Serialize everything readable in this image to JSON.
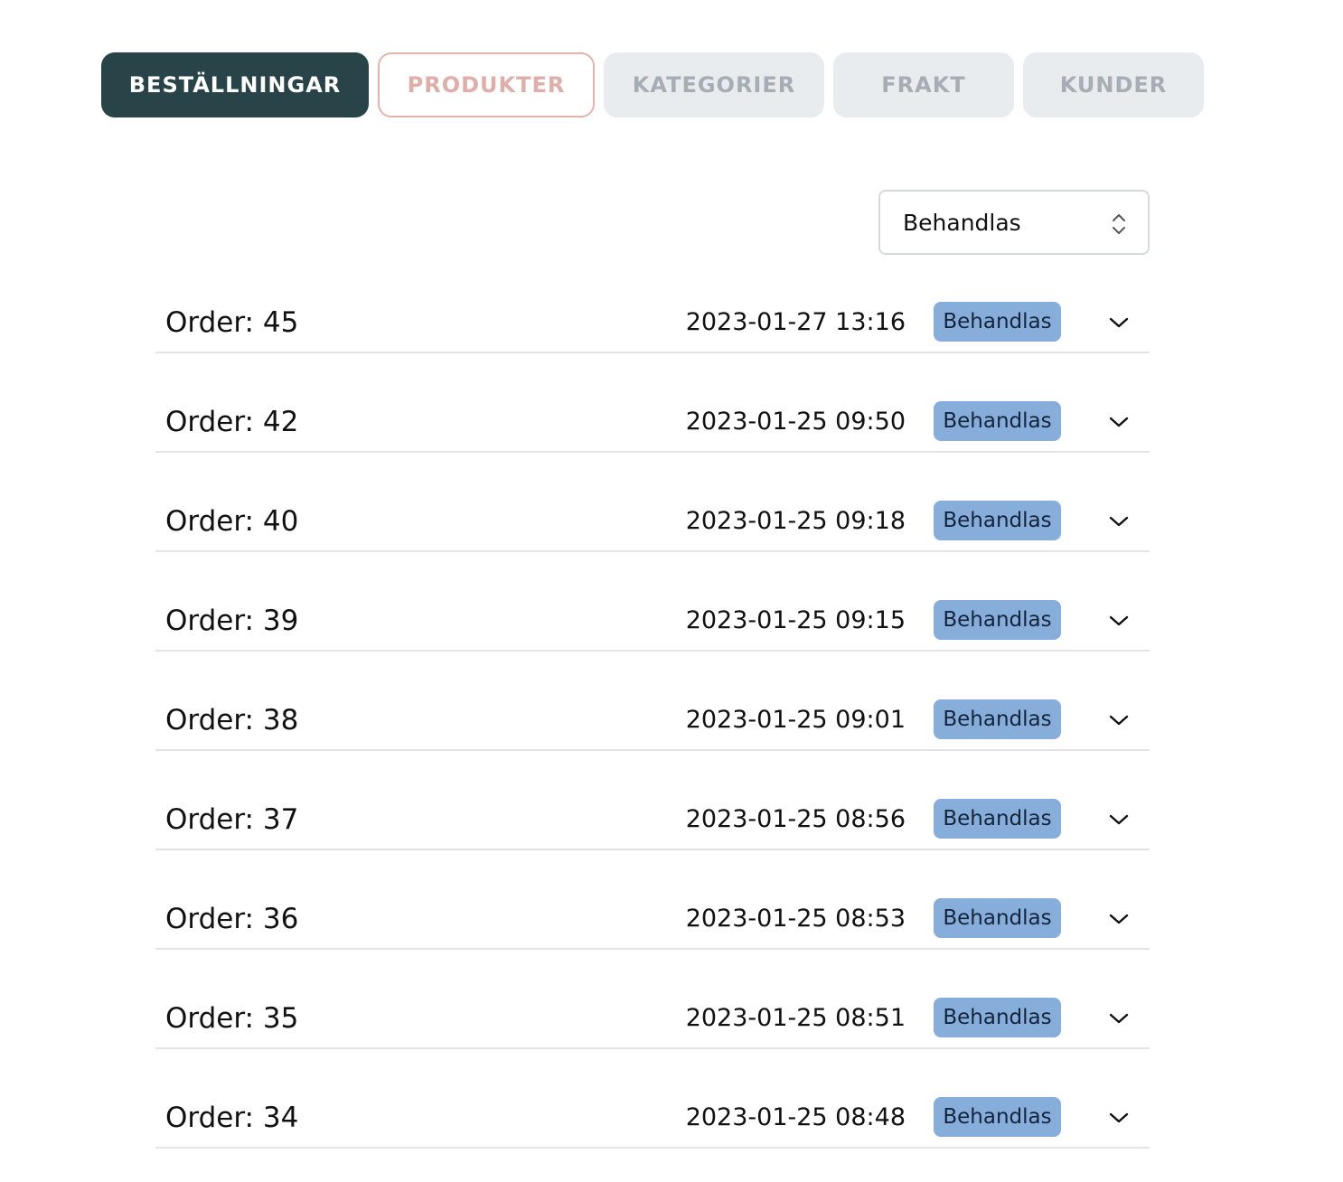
{
  "tabs": [
    {
      "label": "BESTÄLLNINGAR",
      "state": "active"
    },
    {
      "label": "PRODUKTER",
      "state": "outline"
    },
    {
      "label": "KATEGORIER",
      "state": "muted"
    },
    {
      "label": "FRAKT",
      "state": "muted"
    },
    {
      "label": "KUNDER",
      "state": "muted"
    }
  ],
  "filter": {
    "selected": "Behandlas",
    "icon": "updown-chevron-icon"
  },
  "orders": [
    {
      "title": "Order: 45",
      "date": "2023-01-27 13:16",
      "status": "Behandlas"
    },
    {
      "title": "Order: 42",
      "date": "2023-01-25 09:50",
      "status": "Behandlas"
    },
    {
      "title": "Order: 40",
      "date": "2023-01-25 09:18",
      "status": "Behandlas"
    },
    {
      "title": "Order: 39",
      "date": "2023-01-25 09:15",
      "status": "Behandlas"
    },
    {
      "title": "Order: 38",
      "date": "2023-01-25 09:01",
      "status": "Behandlas"
    },
    {
      "title": "Order: 37",
      "date": "2023-01-25 08:56",
      "status": "Behandlas"
    },
    {
      "title": "Order: 36",
      "date": "2023-01-25 08:53",
      "status": "Behandlas"
    },
    {
      "title": "Order: 35",
      "date": "2023-01-25 08:51",
      "status": "Behandlas"
    },
    {
      "title": "Order: 34",
      "date": "2023-01-25 08:48",
      "status": "Behandlas"
    }
  ],
  "colors": {
    "tab_active_bg": "#284449",
    "tab_outline_border": "#e3b4ae",
    "tab_muted_bg": "#e8ecef",
    "badge_bg": "#87aedb"
  }
}
